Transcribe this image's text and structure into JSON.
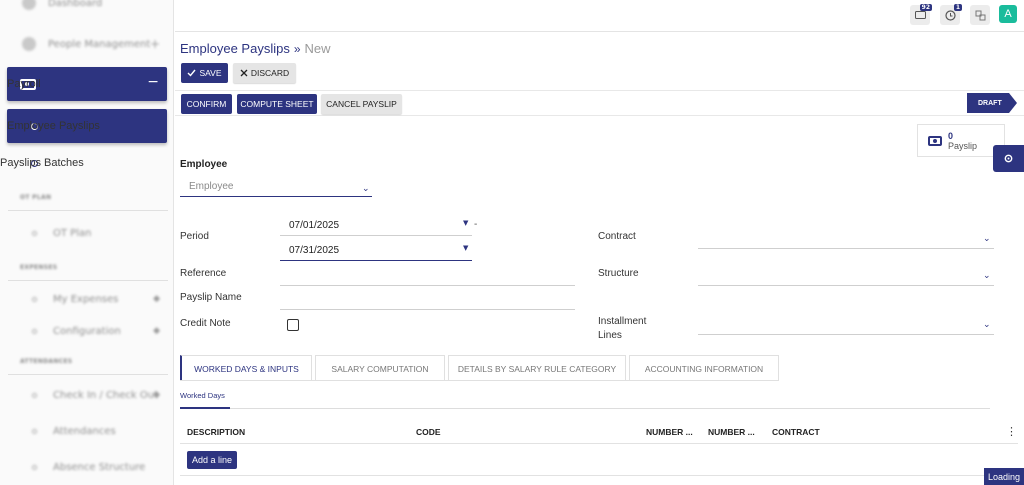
{
  "sidebar": {
    "dashboard": "Dashboard",
    "people_management": "People Management",
    "payroll": "Payroll",
    "payroll_toggle": "−",
    "employee_payslips": "Employee Payslips",
    "payslips_batches": "Payslips Batches",
    "ot_plan_section": "OT PLAN",
    "ot_plan": "OT Plan",
    "expenses_section": "EXPENSES",
    "my_expenses": "My Expenses",
    "configuration": "Configuration",
    "attendances_section": "ATTENDANCES",
    "check_in_out": "Check In / Check Out",
    "attendances": "Attendances",
    "absence_structure": "Absence Structure"
  },
  "topbar": {
    "messages_count": "92",
    "activities_count": "1",
    "avatar_letter": "A"
  },
  "breadcrumb": {
    "parent": "Employee Payslips",
    "separator": "»",
    "current": "New"
  },
  "actions": {
    "save": "SAVE",
    "discard": "DISCARD"
  },
  "header_buttons": {
    "confirm": "CONFIRM",
    "compute_sheet": "COMPUTE SHEET",
    "cancel_payslip": "CANCEL PAYSLIP"
  },
  "status": "DRAFT",
  "smart_button": {
    "count": "0",
    "label": "Payslip"
  },
  "form": {
    "employee_label": "Employee",
    "employee_placeholder": "Employee",
    "period_label": "Period",
    "date_from": "07/01/2025",
    "date_sep": "-",
    "date_to": "07/31/2025",
    "reference_label": "Reference",
    "payslip_name_label": "Payslip Name",
    "credit_note_label": "Credit Note",
    "contract_label": "Contract",
    "structure_label": "Structure",
    "installment_label_1": "Installment",
    "installment_label_2": "Lines"
  },
  "tabs": [
    "WORKED DAYS & INPUTS",
    "SALARY COMPUTATION",
    "DETAILS BY SALARY RULE CATEGORY",
    "ACCOUNTING INFORMATION"
  ],
  "subtab": "Worked Days",
  "table": {
    "columns": [
      "DESCRIPTION",
      "CODE",
      "NUMBER ...",
      "NUMBER ...",
      "CONTRACT"
    ],
    "add_line": "Add a line"
  },
  "loading": "Loading",
  "colors": {
    "primary": "#2d3480",
    "avatar": "#1abc9c"
  }
}
